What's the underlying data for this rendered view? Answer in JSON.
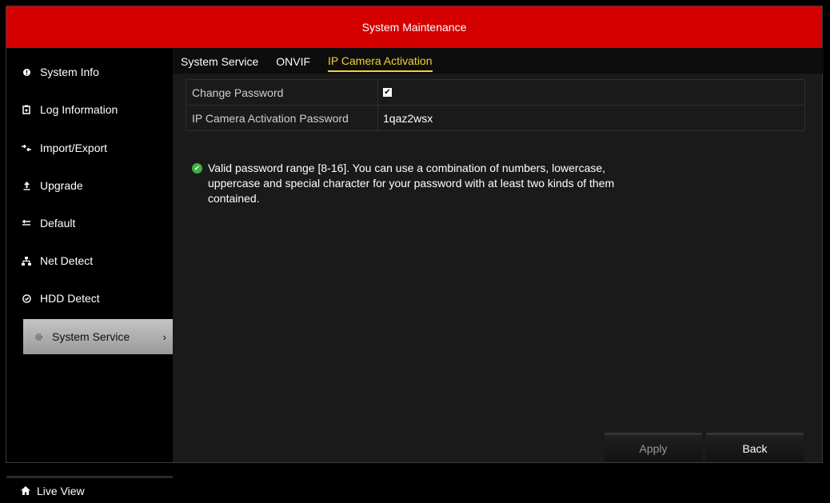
{
  "window": {
    "title": "System Maintenance"
  },
  "sidebar": {
    "items": [
      {
        "label": "System Info",
        "icon": "info-icon"
      },
      {
        "label": "Log Information",
        "icon": "log-icon"
      },
      {
        "label": "Import/Export",
        "icon": "import-export-icon"
      },
      {
        "label": "Upgrade",
        "icon": "upgrade-icon"
      },
      {
        "label": "Default",
        "icon": "default-icon"
      },
      {
        "label": "Net Detect",
        "icon": "network-icon"
      },
      {
        "label": "HDD Detect",
        "icon": "hdd-icon"
      },
      {
        "label": "System Service",
        "icon": "gear-icon",
        "active": true,
        "chevron": "›"
      }
    ],
    "live_view": {
      "label": "Live View",
      "icon": "home-icon"
    }
  },
  "tabs": [
    {
      "label": "System Service"
    },
    {
      "label": "ONVIF"
    },
    {
      "label": "IP Camera Activation",
      "active": true
    }
  ],
  "form": {
    "change_password": {
      "label": "Change Password",
      "checked": true,
      "check_glyph": "✔"
    },
    "activation_password": {
      "label": "IP Camera Activation Password",
      "value": "1qaz2wsx"
    }
  },
  "hint": {
    "icon": "check-circle-icon",
    "glyph": "✔",
    "text": "Valid password range [8-16]. You can use a combination of numbers, lowercase, uppercase and special character for your password with at least two kinds of them contained."
  },
  "buttons": {
    "apply": "Apply",
    "back": "Back"
  },
  "colors": {
    "title_bar": "#d40000",
    "active_tab": "#f4d235",
    "ok_icon": "#3cb043"
  }
}
